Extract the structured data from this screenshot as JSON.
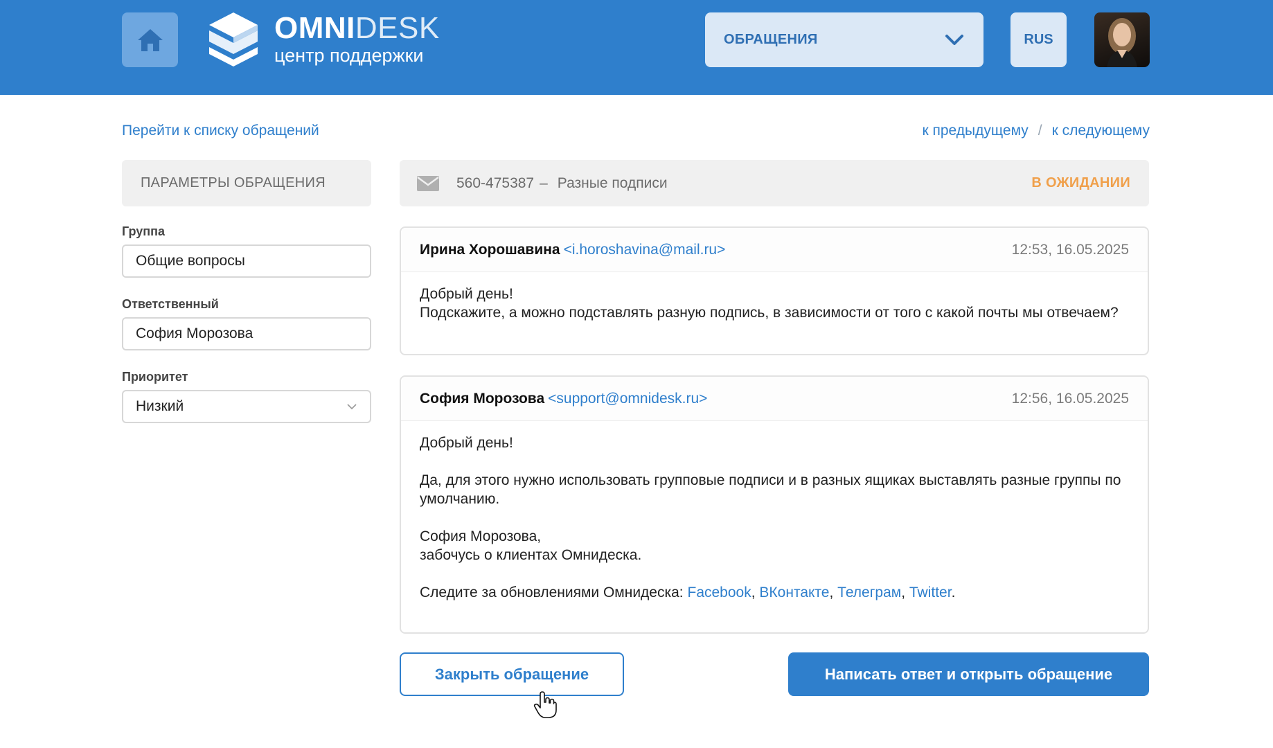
{
  "colors": {
    "brand": "#2f7fcc",
    "status": "#f0a04b",
    "panel": "#f0f0f0"
  },
  "header": {
    "home_icon": "home-icon",
    "logo": {
      "title_bold": "OMNI",
      "title_light": "DESK",
      "subtitle": "центр поддержки"
    },
    "section_dropdown": {
      "label": "ОБРАЩЕНИЯ",
      "icon": "chevron-down-icon"
    },
    "language": "RUS"
  },
  "nav": {
    "back_to_list": "Перейти к списку обращений",
    "prev": "к предыдущему",
    "separator": "/",
    "next": "к следующему"
  },
  "params": {
    "title": "ПАРАМЕТРЫ ОБРАЩЕНИЯ",
    "group_label": "Группа",
    "group_value": "Общие вопросы",
    "assignee_label": "Ответственный",
    "assignee_value": "София Морозова",
    "priority_label": "Приоритет",
    "priority_value": "Низкий"
  },
  "ticket": {
    "number": "560-475387",
    "dash": "–",
    "subject": "Разные подписи",
    "status": "В ОЖИДАНИИ"
  },
  "messages": [
    {
      "author": "Ирина Хорошавина",
      "email": "<i.horoshavina@mail.ru>",
      "time": "12:53, 16.05.2025",
      "lines": [
        "Добрый день!",
        "Подскажите, а можно подставлять разную подпись, в зависимости от того с какой почты мы отвечаем?"
      ]
    },
    {
      "author": "София Морозова",
      "email": "<support@omnidesk.ru>",
      "time": "12:56, 16.05.2025",
      "greeting": "Добрый день!",
      "text": "Да, для этого нужно использовать групповые подписи и в разных ящиках выставлять разные группы по умолчанию.",
      "sign_name": "София Морозова,",
      "sign_role": "забочусь о клиентах Омнидеска.",
      "follow_text": "Следите за обновлениями Омнидеска:",
      "links": [
        "Facebook",
        "ВКонтакте",
        "Телеграм",
        "Twitter"
      ],
      "comma": ",",
      "period": "."
    }
  ],
  "actions": {
    "close_ticket": "Закрыть обращение",
    "reply_open": "Написать ответ и открыть обращение"
  }
}
